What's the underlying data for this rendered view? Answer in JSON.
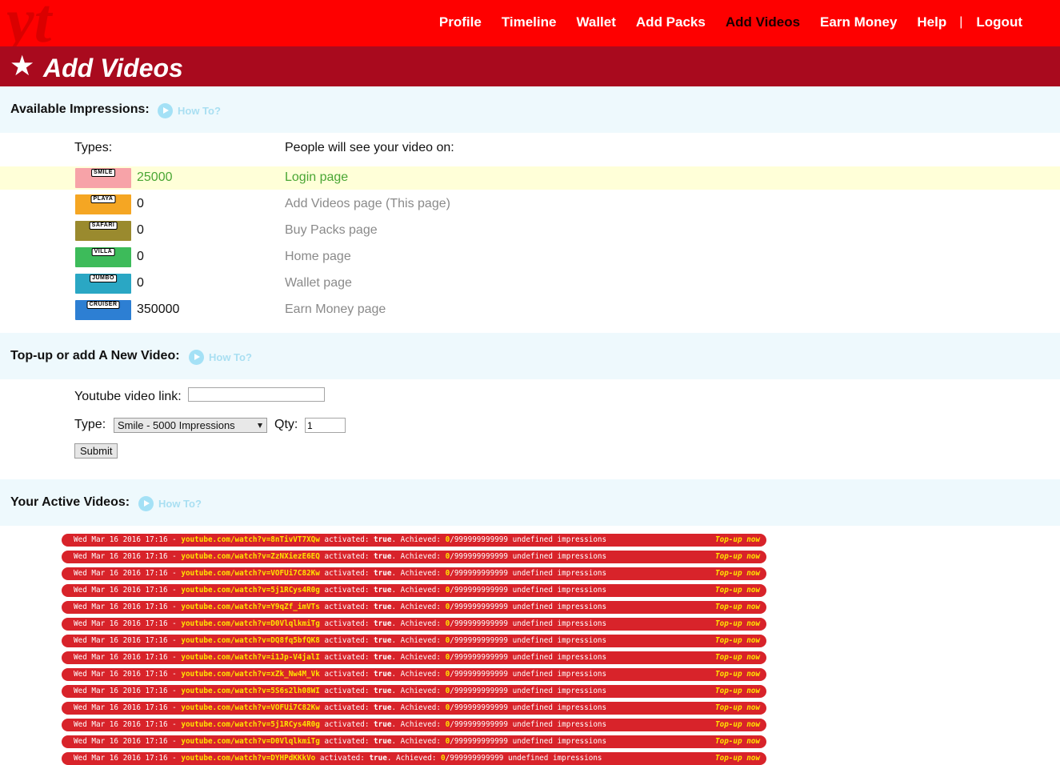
{
  "header": {
    "logo_text": "yt",
    "nav": [
      {
        "label": "Profile",
        "active": false
      },
      {
        "label": "Timeline",
        "active": false
      },
      {
        "label": "Wallet",
        "active": false
      },
      {
        "label": "Add Packs",
        "active": false
      },
      {
        "label": "Add Videos",
        "active": true
      },
      {
        "label": "Earn Money",
        "active": false
      },
      {
        "label": "Help",
        "active": false
      },
      {
        "label": "|",
        "separator": true
      },
      {
        "label": "Logout",
        "active": false
      }
    ]
  },
  "page_title": "Add Videos",
  "impressions": {
    "heading": "Available Impressions:",
    "howto": "How To?",
    "col_types": "Types:",
    "col_pages": "People will see your video on:",
    "rows": [
      {
        "badge": "SMILE",
        "count": "25000",
        "page": "Login page",
        "highlight": true,
        "color": "#f7a3a8"
      },
      {
        "badge": "PLAYA",
        "count": "0",
        "page": "Add Videos page (This page)",
        "highlight": false,
        "color": "#f5a623"
      },
      {
        "badge": "SAFARI",
        "count": "0",
        "page": "Buy Packs page",
        "highlight": false,
        "color": "#9a8a2e"
      },
      {
        "badge": "VILLA",
        "count": "0",
        "page": "Home page",
        "highlight": false,
        "color": "#3dbb5a"
      },
      {
        "badge": "JUMBO",
        "count": "0",
        "page": "Wallet page",
        "highlight": false,
        "color": "#2aa7c4"
      },
      {
        "badge": "CRUISER",
        "count": "350000",
        "page": "Earn Money page",
        "highlight": false,
        "color": "#2d7fd3"
      }
    ]
  },
  "topup": {
    "heading": "Top-up or add A New Video:",
    "howto": "How To?",
    "link_label": "Youtube video link:",
    "link_value": "",
    "type_label": "Type:",
    "type_value": "Smile - 5000 Impressions",
    "qty_label": "Qty:",
    "qty_value": "1",
    "submit_label": "Submit"
  },
  "active": {
    "heading": "Your Active Videos:",
    "howto": "How To?",
    "rows": [
      {
        "date": "Wed Mar 16 2016 17:16 -",
        "link": "youtube.com/watch?v=8nTivVT7XQw",
        "activated": "true",
        "achieved": "0",
        "rest": "/999999999999 undefined impressions",
        "topup": "Top-up now"
      },
      {
        "date": "Wed Mar 16 2016 17:16 -",
        "link": "youtube.com/watch?v=ZzNXiezE6EQ",
        "activated": "true",
        "achieved": "0",
        "rest": "/999999999999 undefined impressions",
        "topup": "Top-up now"
      },
      {
        "date": "Wed Mar 16 2016 17:16 -",
        "link": "youtube.com/watch?v=VOFUi7C82Kw",
        "activated": "true",
        "achieved": "0",
        "rest": "/999999999999 undefined impressions",
        "topup": "Top-up now"
      },
      {
        "date": "Wed Mar 16 2016 17:16 -",
        "link": "youtube.com/watch?v=5j1RCys4R0g",
        "activated": "true",
        "achieved": "0",
        "rest": "/999999999999 undefined impressions",
        "topup": "Top-up now"
      },
      {
        "date": "Wed Mar 16 2016 17:16 -",
        "link": "youtube.com/watch?v=Y9qZf_imVTs",
        "activated": "true",
        "achieved": "0",
        "rest": "/999999999999 undefined impressions",
        "topup": "Top-up now"
      },
      {
        "date": "Wed Mar 16 2016 17:16 -",
        "link": "youtube.com/watch?v=D0VlqlkmiTg",
        "activated": "true",
        "achieved": "0",
        "rest": "/999999999999 undefined impressions",
        "topup": "Top-up now"
      },
      {
        "date": "Wed Mar 16 2016 17:16 -",
        "link": "youtube.com/watch?v=DQ8fq5bfQK8",
        "activated": "true",
        "achieved": "0",
        "rest": "/999999999999 undefined impressions",
        "topup": "Top-up now"
      },
      {
        "date": "Wed Mar 16 2016 17:16 -",
        "link": "youtube.com/watch?v=i1Jp-V4jalI",
        "activated": "true",
        "achieved": "0",
        "rest": "/999999999999 undefined impressions",
        "topup": "Top-up now"
      },
      {
        "date": "Wed Mar 16 2016 17:16 -",
        "link": "youtube.com/watch?v=xZk_Nw4M_Vk",
        "activated": "true",
        "achieved": "0",
        "rest": "/999999999999 undefined impressions",
        "topup": "Top-up now"
      },
      {
        "date": "Wed Mar 16 2016 17:16 -",
        "link": "youtube.com/watch?v=5S6s2lh08WI",
        "activated": "true",
        "achieved": "0",
        "rest": "/999999999999 undefined impressions",
        "topup": "Top-up now"
      },
      {
        "date": "Wed Mar 16 2016 17:16 -",
        "link": "youtube.com/watch?v=VOFUi7C82Kw",
        "activated": "true",
        "achieved": "0",
        "rest": "/999999999999 undefined impressions",
        "topup": "Top-up now"
      },
      {
        "date": "Wed Mar 16 2016 17:16 -",
        "link": "youtube.com/watch?v=5j1RCys4R0g",
        "activated": "true",
        "achieved": "0",
        "rest": "/999999999999 undefined impressions",
        "topup": "Top-up now"
      },
      {
        "date": "Wed Mar 16 2016 17:16 -",
        "link": "youtube.com/watch?v=D0VlqlkmiTg",
        "activated": "true",
        "achieved": "0",
        "rest": "/999999999999 undefined impressions",
        "topup": "Top-up now"
      },
      {
        "date": "Wed Mar 16 2016 17:16 -",
        "link": "youtube.com/watch?v=DYHPdKKkVo",
        "activated": "true",
        "achieved": "0",
        "rest": "/999999999999 undefined impressions",
        "topup": "Top-up now"
      }
    ]
  },
  "colors": {
    "brand_red": "#fe0000",
    "title_red": "#a90a1e",
    "row_red": "#d8232a",
    "accent_yellow": "#ffe400",
    "highlight_green": "#4aa634"
  }
}
